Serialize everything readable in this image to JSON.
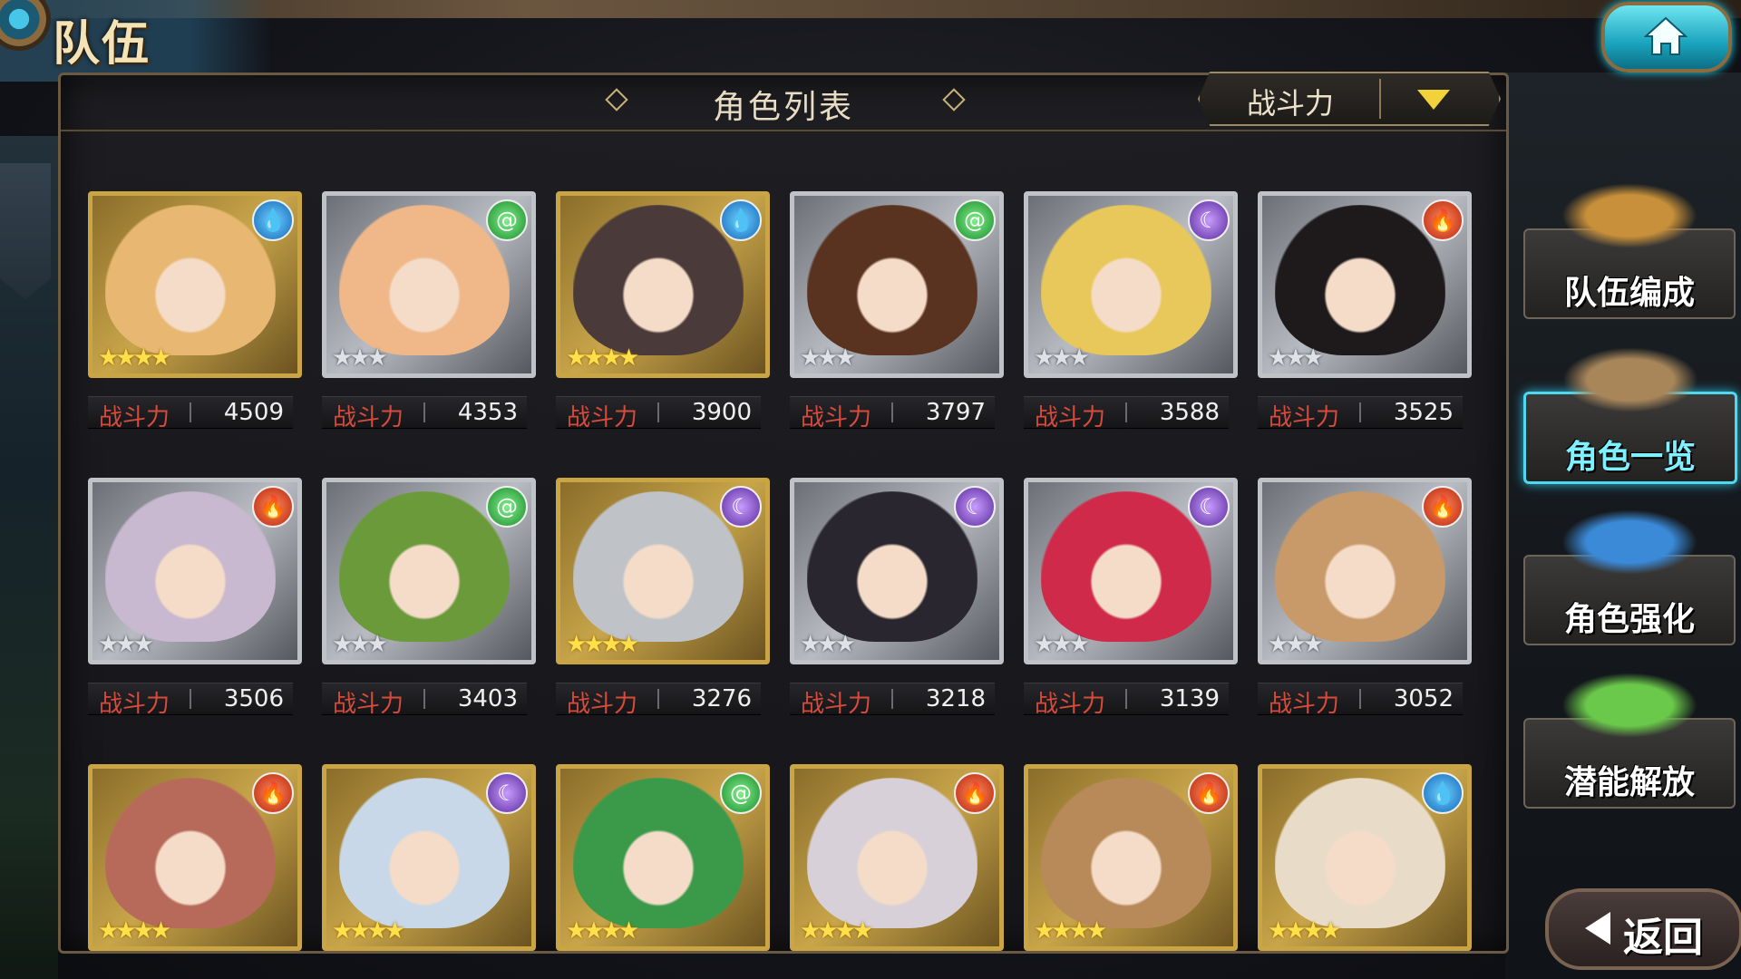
{
  "screen_title": "队伍",
  "panel_title": "角色列表",
  "sort": {
    "label": "战斗力"
  },
  "power_label": "战斗力",
  "characters": [
    {
      "power": "4509",
      "element": "water",
      "rarity": "gold",
      "stars": "★★★★",
      "hair": "#e8b873"
    },
    {
      "power": "4353",
      "element": "wind",
      "rarity": "silver",
      "stars": "★★★",
      "hair": "#f0b889"
    },
    {
      "power": "3900",
      "element": "water",
      "rarity": "gold",
      "stars": "★★★★",
      "hair": "#4a3a3a"
    },
    {
      "power": "3797",
      "element": "wind",
      "rarity": "silver",
      "stars": "★★★",
      "hair": "#5a3220"
    },
    {
      "power": "3588",
      "element": "dark",
      "rarity": "silver",
      "stars": "★★★",
      "hair": "#e8c85a"
    },
    {
      "power": "3525",
      "element": "fire",
      "rarity": "silver",
      "stars": "★★★",
      "hair": "#1e1a1c"
    },
    {
      "power": "3506",
      "element": "fire",
      "rarity": "silver",
      "stars": "★★★",
      "hair": "#c8b8d0"
    },
    {
      "power": "3403",
      "element": "wind",
      "rarity": "silver",
      "stars": "★★★",
      "hair": "#6a9a3a"
    },
    {
      "power": "3276",
      "element": "dark",
      "rarity": "gold",
      "stars": "★★★★",
      "hair": "#bfc3c8"
    },
    {
      "power": "3218",
      "element": "dark",
      "rarity": "silver",
      "stars": "★★★",
      "hair": "#2a2630"
    },
    {
      "power": "3139",
      "element": "dark",
      "rarity": "silver",
      "stars": "★★★",
      "hair": "#d02a4a"
    },
    {
      "power": "3052",
      "element": "fire",
      "rarity": "silver",
      "stars": "★★★",
      "hair": "#c89a6a"
    },
    {
      "element": "fire",
      "rarity": "gold",
      "stars": "★★★★",
      "hair": "#b86a5a"
    },
    {
      "element": "dark",
      "rarity": "gold",
      "stars": "★★★★",
      "hair": "#c8d8e8"
    },
    {
      "element": "wind",
      "rarity": "gold",
      "stars": "★★★★",
      "hair": "#3a9a4a"
    },
    {
      "element": "fire",
      "rarity": "gold",
      "stars": "★★★★",
      "hair": "#d8d0d8"
    },
    {
      "element": "fire",
      "rarity": "gold",
      "stars": "★★★★",
      "hair": "#b88a5a"
    },
    {
      "element": "water",
      "rarity": "gold",
      "stars": "★★★★",
      "hair": "#e8dcc8"
    }
  ],
  "side_menu": [
    {
      "label": "队伍编成",
      "active": false,
      "art": "#c8903a"
    },
    {
      "label": "角色一览",
      "active": true,
      "art": "#a8865a"
    },
    {
      "label": "角色强化",
      "active": false,
      "art": "#3a8ad8"
    },
    {
      "label": "潜能解放",
      "active": false,
      "art": "#6ac84a"
    }
  ],
  "back_label": "返回",
  "element_glyphs": {
    "water": "💧",
    "wind": "@",
    "dark": "☾",
    "fire": "🔥"
  }
}
